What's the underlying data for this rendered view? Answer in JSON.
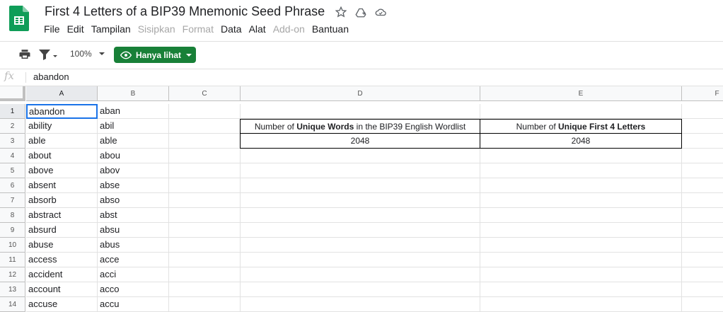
{
  "app": {
    "title": "First 4 Letters of a BIP39 Mnemonic Seed Phrase",
    "icons": [
      "star-icon",
      "drive-move-icon",
      "cloud-status-icon"
    ],
    "brand_color": "#0f9d58"
  },
  "menu": {
    "items": [
      {
        "label": "File",
        "enabled": true
      },
      {
        "label": "Edit",
        "enabled": true
      },
      {
        "label": "Tampilan",
        "enabled": true
      },
      {
        "label": "Sisipkan",
        "enabled": false
      },
      {
        "label": "Format",
        "enabled": false
      },
      {
        "label": "Data",
        "enabled": true
      },
      {
        "label": "Alat",
        "enabled": true
      },
      {
        "label": "Add-on",
        "enabled": false
      },
      {
        "label": "Bantuan",
        "enabled": true
      }
    ]
  },
  "toolbar": {
    "zoom": "100%",
    "view_only_label": "Hanya lihat",
    "view_only_color": "#188038"
  },
  "formula_bar": {
    "fx_label": "fx",
    "value": "abandon"
  },
  "sheet": {
    "columns": [
      "A",
      "B",
      "C",
      "D",
      "E",
      "F"
    ],
    "rows": [
      "1",
      "2",
      "3",
      "4",
      "5",
      "6",
      "7",
      "8",
      "9",
      "10",
      "11",
      "12",
      "13",
      "14"
    ],
    "col_a": [
      "abandon",
      "ability",
      "able",
      "about",
      "above",
      "absent",
      "absorb",
      "abstract",
      "absurd",
      "abuse",
      "access",
      "accident",
      "account",
      "accuse"
    ],
    "col_b": [
      "aban",
      "abil",
      "able",
      "abou",
      "abov",
      "abse",
      "abso",
      "abst",
      "absu",
      "abus",
      "acce",
      "acci",
      "acco",
      "accu"
    ],
    "d2": {
      "pre": "Number of ",
      "bold": "Unique Words",
      "post": " in the BIP39 English Wordlist"
    },
    "d3": "2048",
    "e2": {
      "pre": "Number of ",
      "bold": "Unique First 4 Letters",
      "post": ""
    },
    "e3": "2048",
    "active_cell": "A1",
    "selection_color": "#1a73e8"
  }
}
